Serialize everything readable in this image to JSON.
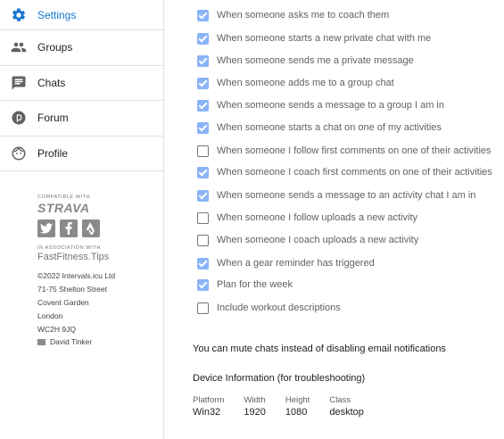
{
  "sidebar": {
    "items": [
      {
        "label": "Settings",
        "icon": "gear-icon"
      },
      {
        "label": "Groups",
        "icon": "groups-icon"
      },
      {
        "label": "Chats",
        "icon": "chat-icon"
      },
      {
        "label": "Forum",
        "icon": "forum-icon"
      },
      {
        "label": "Profile",
        "icon": "profile-icon"
      }
    ],
    "compatible": "COMPATIBLE WITH",
    "strava": "STRAVA",
    "association": "IN ASSOCIATION WITH",
    "fft": "FastFitness.Tips",
    "address": [
      "©2022 Intervals.icu Ltd",
      "71-75 Shelton Street",
      "Covent Garden",
      "London",
      "WC2H 9JQ"
    ],
    "user": "David Tinker"
  },
  "notifications": [
    {
      "label": "When someone asks me to coach them",
      "checked": true
    },
    {
      "label": "When someone starts a new private chat with me",
      "checked": true
    },
    {
      "label": "When someone sends me a private message",
      "checked": true
    },
    {
      "label": "When someone adds me to a group chat",
      "checked": true
    },
    {
      "label": "When someone sends a message to a group I am in",
      "checked": true
    },
    {
      "label": "When someone starts a chat on one of my activities",
      "checked": true
    },
    {
      "label": "When someone I follow first comments on one of their activities",
      "checked": false
    },
    {
      "label": "When someone I coach first comments on one of their activities",
      "checked": true
    },
    {
      "label": "When someone sends a message to an activity chat I am in",
      "checked": true
    },
    {
      "label": "When someone I follow uploads a new activity",
      "checked": false
    },
    {
      "label": "When someone I coach uploads a new activity",
      "checked": false
    },
    {
      "label": "When a gear reminder has triggered",
      "checked": true
    },
    {
      "label": "Plan for the week",
      "checked": true
    },
    {
      "label": "Include workout descriptions",
      "checked": false
    }
  ],
  "mute_text": "You can mute chats instead of disabling email notifications",
  "device": {
    "title": "Device Information (for troubleshooting)",
    "columns": [
      {
        "header": "Platform",
        "value": "Win32"
      },
      {
        "header": "Width",
        "value": "1920"
      },
      {
        "header": "Height",
        "value": "1080"
      },
      {
        "header": "Class",
        "value": "desktop"
      }
    ]
  },
  "colors": {
    "accent": "#1976d2",
    "checkbox": "#8ab4f8"
  }
}
